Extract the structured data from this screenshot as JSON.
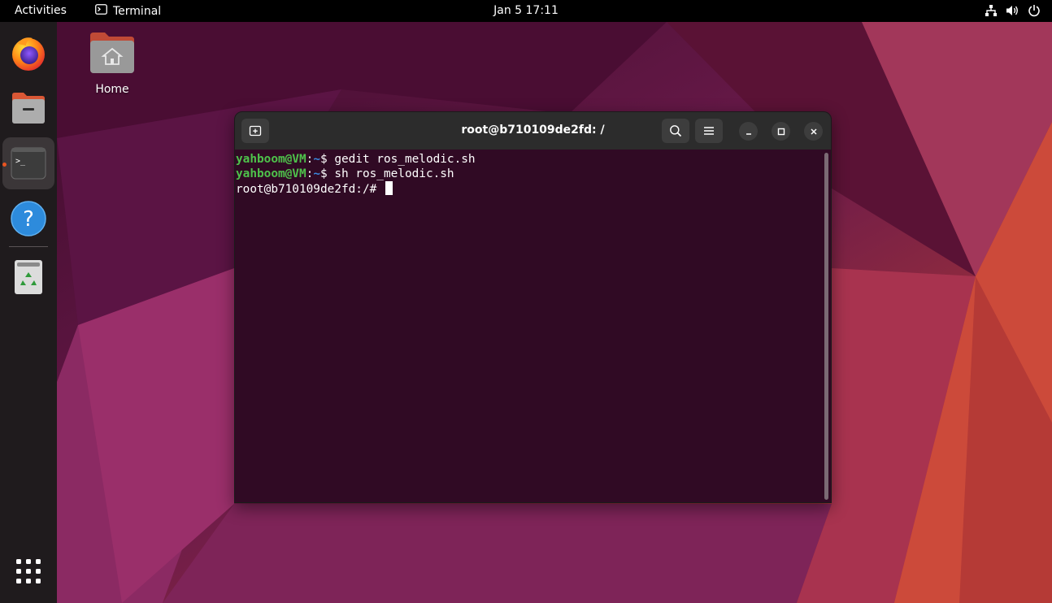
{
  "topbar": {
    "activities": "Activities",
    "app_name": "Terminal",
    "app_icon": "terminal-icon",
    "clock": "Jan 5  17:11",
    "tray_icons": [
      "network-icon",
      "volume-icon",
      "power-icon"
    ]
  },
  "dock": {
    "items": [
      {
        "name": "Firefox",
        "icon": "firefox-icon"
      },
      {
        "name": "Files",
        "icon": "files-icon"
      },
      {
        "name": "Terminal",
        "icon": "terminal-icon",
        "active": true,
        "running": true
      },
      {
        "name": "Help",
        "icon": "help-icon",
        "glyph": "?"
      },
      {
        "name": "Trash",
        "icon": "trash-icon"
      }
    ],
    "show_apps_icon": "app-grid-icon"
  },
  "desktop": {
    "home_label": "Home"
  },
  "terminal": {
    "title": "root@b710109de2fd: /",
    "lines": [
      {
        "user": "yahboom@VM",
        "sep": ":",
        "path": "~",
        "prompt": "$ ",
        "command": "gedit ros_melodic.sh"
      },
      {
        "user": "yahboom@VM",
        "sep": ":",
        "path": "~",
        "prompt": "$ ",
        "command": "sh ros_melodic.sh"
      }
    ],
    "current_prompt": "root@b710109de2fd:/# "
  },
  "colors": {
    "accent": "#e95420",
    "terminal_bg": "#300a24",
    "prompt_user": "#4ec24b",
    "prompt_path": "#3a8be0"
  }
}
